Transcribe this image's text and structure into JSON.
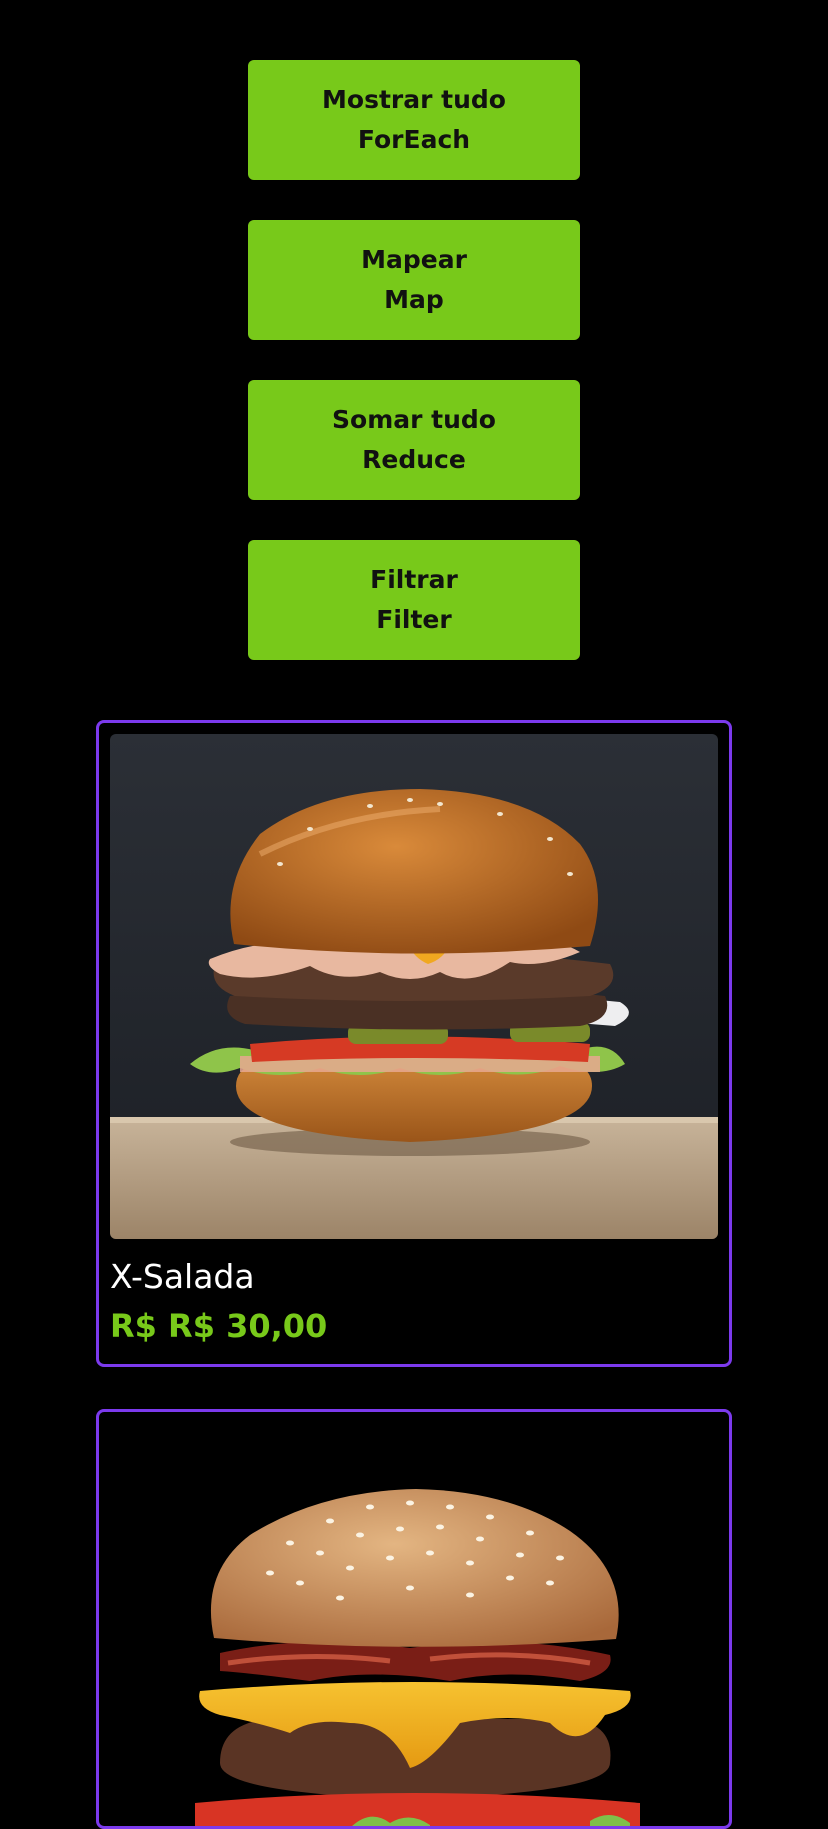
{
  "buttons": [
    {
      "line1": "Mostrar tudo",
      "line2": "ForEach"
    },
    {
      "line1": "Mapear",
      "line2": "Map"
    },
    {
      "line1": "Somar tudo",
      "line2": "Reduce"
    },
    {
      "line1": "Filtrar",
      "line2": "Filter"
    }
  ],
  "products": [
    {
      "name": "X-Salada",
      "price": "R$ R$ 30,00",
      "image": "burger-lettuce-image"
    },
    {
      "image": "burger-bacon-cheese-image"
    }
  ],
  "colors": {
    "background": "#000000",
    "button": "#78c91a",
    "button_text": "#111111",
    "card_border": "#7c3aed",
    "price": "#78c91a",
    "name": "#ffffff"
  }
}
